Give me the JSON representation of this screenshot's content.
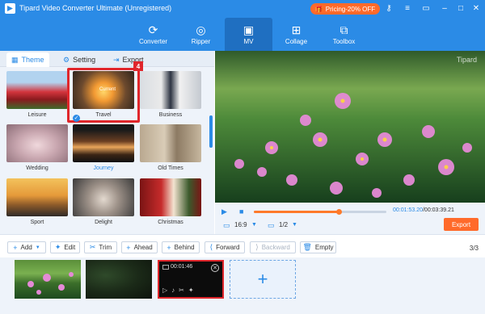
{
  "window": {
    "title": "Tipard Video Converter Ultimate (Unregistered)",
    "promo_label": "Pricing-20% OFF",
    "icons": [
      "gift-icon",
      "key-icon",
      "menu-icon",
      "feedback-icon",
      "minimize-icon",
      "maximize-icon",
      "close-icon"
    ]
  },
  "nav": {
    "items": [
      {
        "label": "Converter",
        "icon": "converter-icon"
      },
      {
        "label": "Ripper",
        "icon": "ripper-icon"
      },
      {
        "label": "MV",
        "icon": "mv-icon",
        "active": true
      },
      {
        "label": "Collage",
        "icon": "collage-icon"
      },
      {
        "label": "Toolbox",
        "icon": "toolbox-icon"
      }
    ]
  },
  "panel": {
    "tabs": [
      {
        "label": "Theme",
        "active": true
      },
      {
        "label": "Setting"
      },
      {
        "label": "Export"
      }
    ],
    "themes": [
      {
        "label": "Leisure"
      },
      {
        "label": "Travel"
      },
      {
        "label": "Business"
      },
      {
        "label": "Wedding"
      },
      {
        "label": "Journey",
        "selected": true
      },
      {
        "label": "Old Times"
      },
      {
        "label": "Sport"
      },
      {
        "label": "Delight"
      },
      {
        "label": "Christmas"
      }
    ],
    "current_tag": "Current",
    "callout_number": "4"
  },
  "preview": {
    "watermark": "Tipard",
    "time_current": "00:01:53.20",
    "time_total": "/00:03:39.21",
    "progress": 0.64,
    "aspect_ratio": "16:9",
    "page": "1/2",
    "export_label": "Export"
  },
  "toolbar": {
    "add": "Add",
    "edit": "Edit",
    "trim": "Trim",
    "ahead": "Ahead",
    "behind": "Behind",
    "forward": "Forward",
    "backward": "Backward",
    "empty": "Empty",
    "count": "3/3"
  },
  "timeline": {
    "clip3_duration": "00:01:46",
    "add_glyph": "+"
  },
  "colors": {
    "accent": "#2b8be6",
    "highlight": "#e0262b",
    "promo": "#ff6a2a"
  }
}
